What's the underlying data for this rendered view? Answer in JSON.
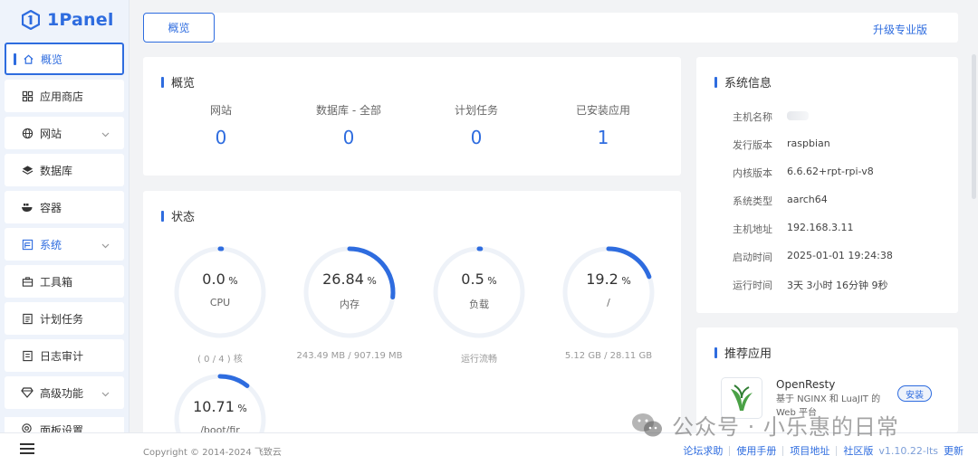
{
  "app": {
    "logo_text": "1Panel"
  },
  "sidebar": {
    "items": [
      {
        "label": "概览",
        "icon": "home-icon",
        "active": true
      },
      {
        "label": "应用商店",
        "icon": "grid-icon"
      },
      {
        "label": "网站",
        "icon": "globe-icon",
        "expandable": true
      },
      {
        "label": "数据库",
        "icon": "layers-icon"
      },
      {
        "label": "容器",
        "icon": "whale-icon"
      },
      {
        "label": "系统",
        "icon": "system-icon",
        "expandable": true,
        "highlight": true
      },
      {
        "label": "工具箱",
        "icon": "toolbox-icon"
      },
      {
        "label": "计划任务",
        "icon": "task-icon"
      },
      {
        "label": "日志审计",
        "icon": "log-icon"
      },
      {
        "label": "高级功能",
        "icon": "diamond-icon",
        "expandable": true
      },
      {
        "label": "面板设置",
        "icon": "settings-icon"
      }
    ]
  },
  "topbar": {
    "tab_label": "概览",
    "upgrade_label": "升级专业版"
  },
  "overview": {
    "title": "概览",
    "stats": [
      {
        "label": "网站",
        "value": "0"
      },
      {
        "label": "数据库 - 全部",
        "value": "0"
      },
      {
        "label": "计划任务",
        "value": "0"
      },
      {
        "label": "已安装应用",
        "value": "1"
      }
    ]
  },
  "status": {
    "title": "状态",
    "gauges": [
      {
        "value": "0.0",
        "unit": "%",
        "name": "CPU",
        "percent": 0.0,
        "foot": "( 0 / 4 ) 核"
      },
      {
        "value": "26.84",
        "unit": "%",
        "name": "内存",
        "percent": 26.84,
        "foot": "243.49 MB / 907.19 MB"
      },
      {
        "value": "0.5",
        "unit": "%",
        "name": "负载",
        "percent": 0.5,
        "foot": "运行流畅"
      },
      {
        "value": "19.2",
        "unit": "%",
        "name": "/",
        "percent": 19.2,
        "foot": "5.12 GB / 28.11 GB"
      },
      {
        "value": "10.71",
        "unit": "%",
        "name": "/boot/fir",
        "percent": 10.71,
        "foot": ""
      }
    ]
  },
  "sysinfo": {
    "title": "系统信息",
    "rows": [
      {
        "key": "主机名称",
        "value": ""
      },
      {
        "key": "发行版本",
        "value": "raspbian"
      },
      {
        "key": "内核版本",
        "value": "6.6.62+rpt-rpi-v8"
      },
      {
        "key": "系统类型",
        "value": "aarch64"
      },
      {
        "key": "主机地址",
        "value": "192.168.3.11"
      },
      {
        "key": "启动时间",
        "value": "2025-01-01 19:24:38"
      },
      {
        "key": "运行时间",
        "value": "3天 3小时 16分钟 9秒"
      }
    ]
  },
  "recommend": {
    "title": "推荐应用",
    "app": {
      "name": "OpenResty",
      "desc": "基于 NGINX 和 LuaJIT 的 Web 平台",
      "install_label": "安装"
    }
  },
  "footer": {
    "copyright": "Copyright © 2014-2024 飞致云",
    "links": [
      "论坛求助",
      "使用手册",
      "项目地址",
      "社区版"
    ],
    "version": "v1.10.22-lts",
    "update_label": "更新"
  },
  "watermark": {
    "text": "公众号 · 小乐惠的日常"
  },
  "colors": {
    "accent": "#2e6cdf",
    "sidebar_bg": "#eef3fb",
    "page_bg": "#f2f3f5"
  }
}
